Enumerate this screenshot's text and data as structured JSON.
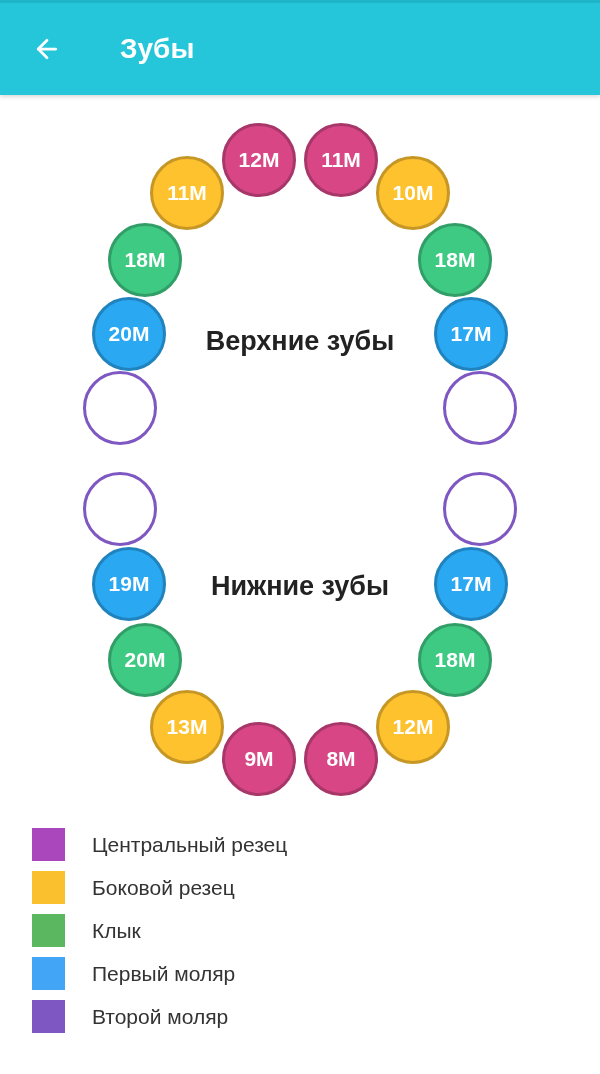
{
  "app_bar": {
    "title": "Зубы"
  },
  "upper_jaw": {
    "label": "Верхние зубы",
    "teeth": [
      {
        "color": "#7e57c2",
        "filled": false
      },
      {
        "label": "20M",
        "color": "#2aa8f2",
        "filled": true
      },
      {
        "label": "18M",
        "color": "#3fca84",
        "filled": true
      },
      {
        "label": "11M",
        "color": "#fec22f",
        "filled": true
      },
      {
        "label": "12M",
        "color": "#d84686",
        "filled": true
      },
      {
        "label": "11M",
        "color": "#d84686",
        "filled": true
      },
      {
        "label": "10M",
        "color": "#fec22f",
        "filled": true
      },
      {
        "label": "18M",
        "color": "#3fca84",
        "filled": true
      },
      {
        "label": "17M",
        "color": "#2aa8f2",
        "filled": true
      },
      {
        "color": "#7e57c2",
        "filled": false
      }
    ]
  },
  "lower_jaw": {
    "label": "Нижние зубы",
    "teeth": [
      {
        "color": "#7e57c2",
        "filled": false
      },
      {
        "label": "19M",
        "color": "#2aa8f2",
        "filled": true
      },
      {
        "label": "20M",
        "color": "#3fca84",
        "filled": true
      },
      {
        "label": "13M",
        "color": "#fec22f",
        "filled": true
      },
      {
        "label": "9M",
        "color": "#d84686",
        "filled": true
      },
      {
        "label": "8M",
        "color": "#d84686",
        "filled": true
      },
      {
        "label": "12M",
        "color": "#fec22f",
        "filled": true
      },
      {
        "label": "18M",
        "color": "#3fca84",
        "filled": true
      },
      {
        "label": "17M",
        "color": "#2aa8f2",
        "filled": true
      },
      {
        "color": "#7e57c2",
        "filled": false
      }
    ]
  },
  "legend": [
    {
      "label": "Центральный резец",
      "color": "#ab47bc"
    },
    {
      "label": "Боковой резец",
      "color": "#fbc02d"
    },
    {
      "label": "Клык",
      "color": "#5cb860"
    },
    {
      "label": "Первый моляр",
      "color": "#42a5f5"
    },
    {
      "label": "Второй моляр",
      "color": "#7e57c2"
    }
  ]
}
